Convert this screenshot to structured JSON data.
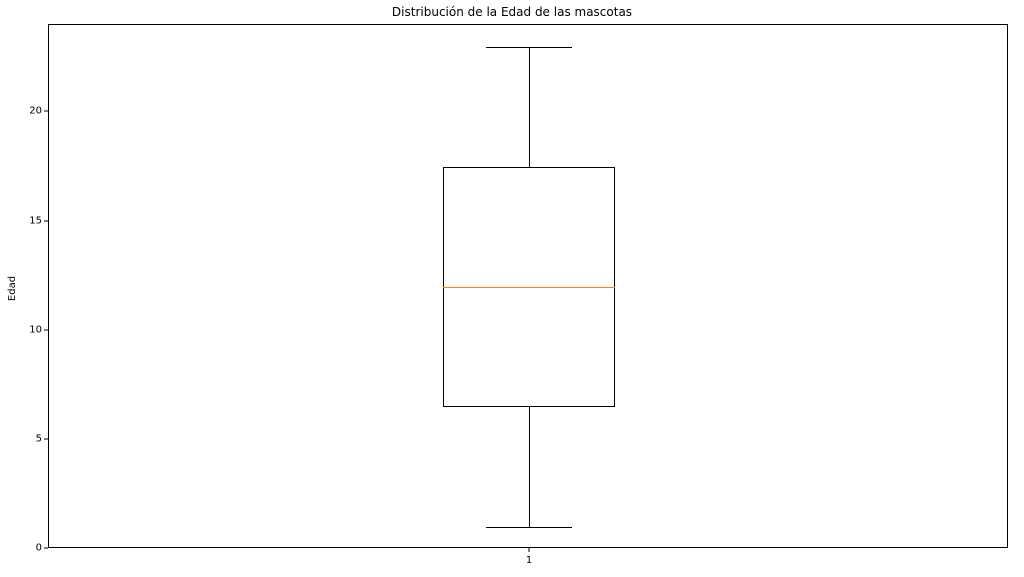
{
  "chart_data": {
    "type": "boxplot",
    "title": "Distribución de la Edad de las mascotas",
    "ylabel": "Edad",
    "xlabel": "",
    "ylim": [
      0,
      24
    ],
    "yticks": [
      0,
      5,
      10,
      15,
      20
    ],
    "xticks": [
      "1"
    ],
    "series": [
      {
        "name": "1",
        "min": 1,
        "q1": 6.5,
        "median": 12,
        "q3": 17.5,
        "max": 23,
        "outliers": []
      }
    ],
    "box_width_frac": 0.18,
    "cap_width_frac": 0.09,
    "colors": {
      "box_edge": "#000000",
      "median": "#ff7f0e",
      "whisker": "#000000"
    }
  }
}
